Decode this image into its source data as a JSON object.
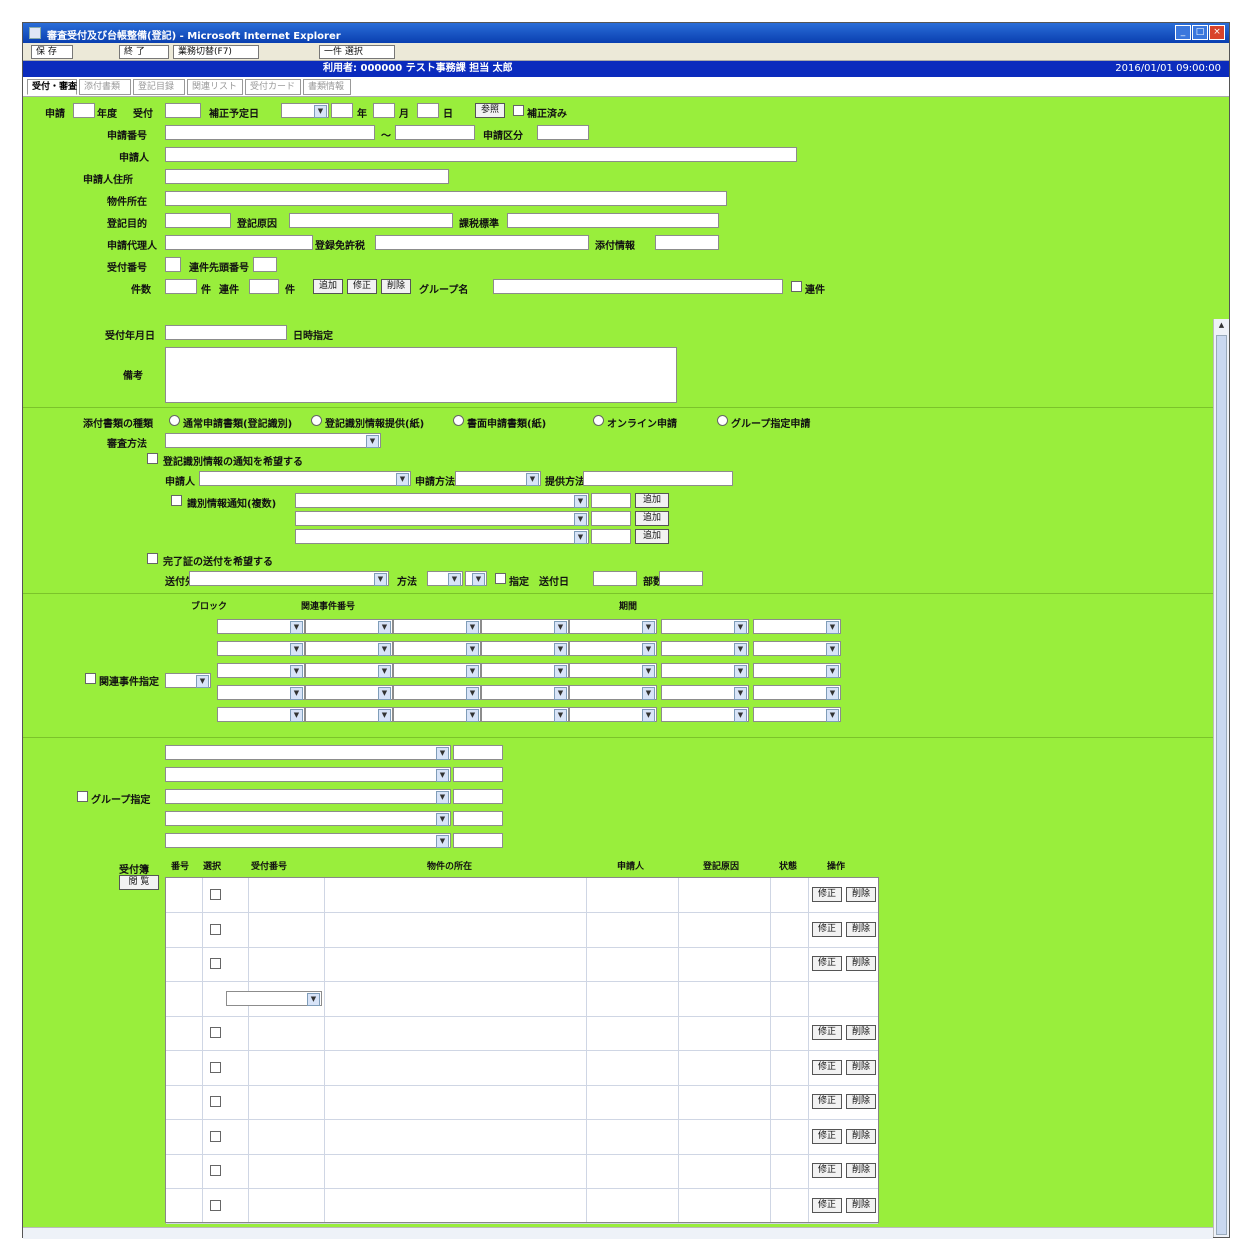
{
  "window": {
    "title": "審査受付及び台帳整備(登記)  -  Microsoft Internet Explorer",
    "controls": [
      "_",
      "□",
      "×"
    ]
  },
  "toolbar": {
    "buttons": [
      "保 存",
      "終 了",
      "業務切替(F7)"
    ],
    "select_value": "一件 選択"
  },
  "header": {
    "center_text": "利用者: 000000  テスト事務課  担当  太郎",
    "right_text": "2016/01/01 09:00:00"
  },
  "tabs": [
    "受付・審査",
    "添付書類",
    "登記目録",
    "関連リスト",
    "受付カード",
    "書類情報"
  ],
  "top_form": {
    "row1": {
      "label": "申請",
      "l2": "年度",
      "l3": "受付",
      "l4": "補正予定日",
      "l5": "年",
      "l6": "月",
      "l7": "日",
      "btn": "参照",
      "chk": "補正済み"
    },
    "row2": {
      "label": "申請番号",
      "mid": "〜",
      "r_label": "申請区分"
    },
    "row3": {
      "label": "申請人"
    },
    "row4": {
      "label": "申請人住所"
    },
    "row5": {
      "label": "物件所在"
    },
    "row6": {
      "label": "登記目的",
      "m_label": "登記原因",
      "r_label": "課税標準"
    },
    "row7": {
      "label": "申請代理人",
      "m_label": "登録免許税",
      "r_label": "添付情報"
    },
    "row8": {
      "label": "受付番号",
      "m_label": "連件先頭番号"
    },
    "row9": {
      "label": "件数",
      "l2": "件",
      "l3": "連件",
      "l4": "件",
      "btn1": "追加",
      "btn2": "修正",
      "btn3": "削除",
      "g_label": "グループ名",
      "chk": "連件"
    }
  },
  "main_form": {
    "upper_label": "受付年月日",
    "upper_right": "日時指定",
    "memo_label": "備考",
    "doc_label": "添付書類の種類",
    "radios": [
      "通常申請書類(登記識別)",
      "登記識別情報提供(紙)",
      "書面申請書類(紙)",
      "オンライン申請",
      "グループ指定申請"
    ],
    "shinsa_label": "審査方法",
    "chk_a": "登記識別情報の通知を希望する",
    "sub_a_labels": [
      "申請人",
      "申請方法",
      "提供方法"
    ],
    "chk_b": "識別情報通知(複数)",
    "sub_b_btns": [
      "追加",
      "追加",
      "追加"
    ],
    "chk_c": "完了証の送付を希望する",
    "sub_c_labels": [
      "送付先",
      "方法",
      "部数",
      "指定",
      "送付日"
    ],
    "cal_label": "関連事件指定",
    "cal_headers": [
      "ブロック",
      "関連事件番号",
      "期間"
    ],
    "grp_label": "グループ指定",
    "list_label": "受付簿",
    "list_sub_label": "閲 覧",
    "list_headers": [
      "番号",
      "選択",
      "受付番号",
      "物件の所在",
      "申請人",
      "登記原因",
      "状態",
      "操作"
    ],
    "row_btns": [
      "修正",
      "削除"
    ]
  },
  "colors": {
    "panel_green": "#99ee3c",
    "header_blue": "#0b2bbd",
    "title_blue": "#2a6dd8"
  }
}
